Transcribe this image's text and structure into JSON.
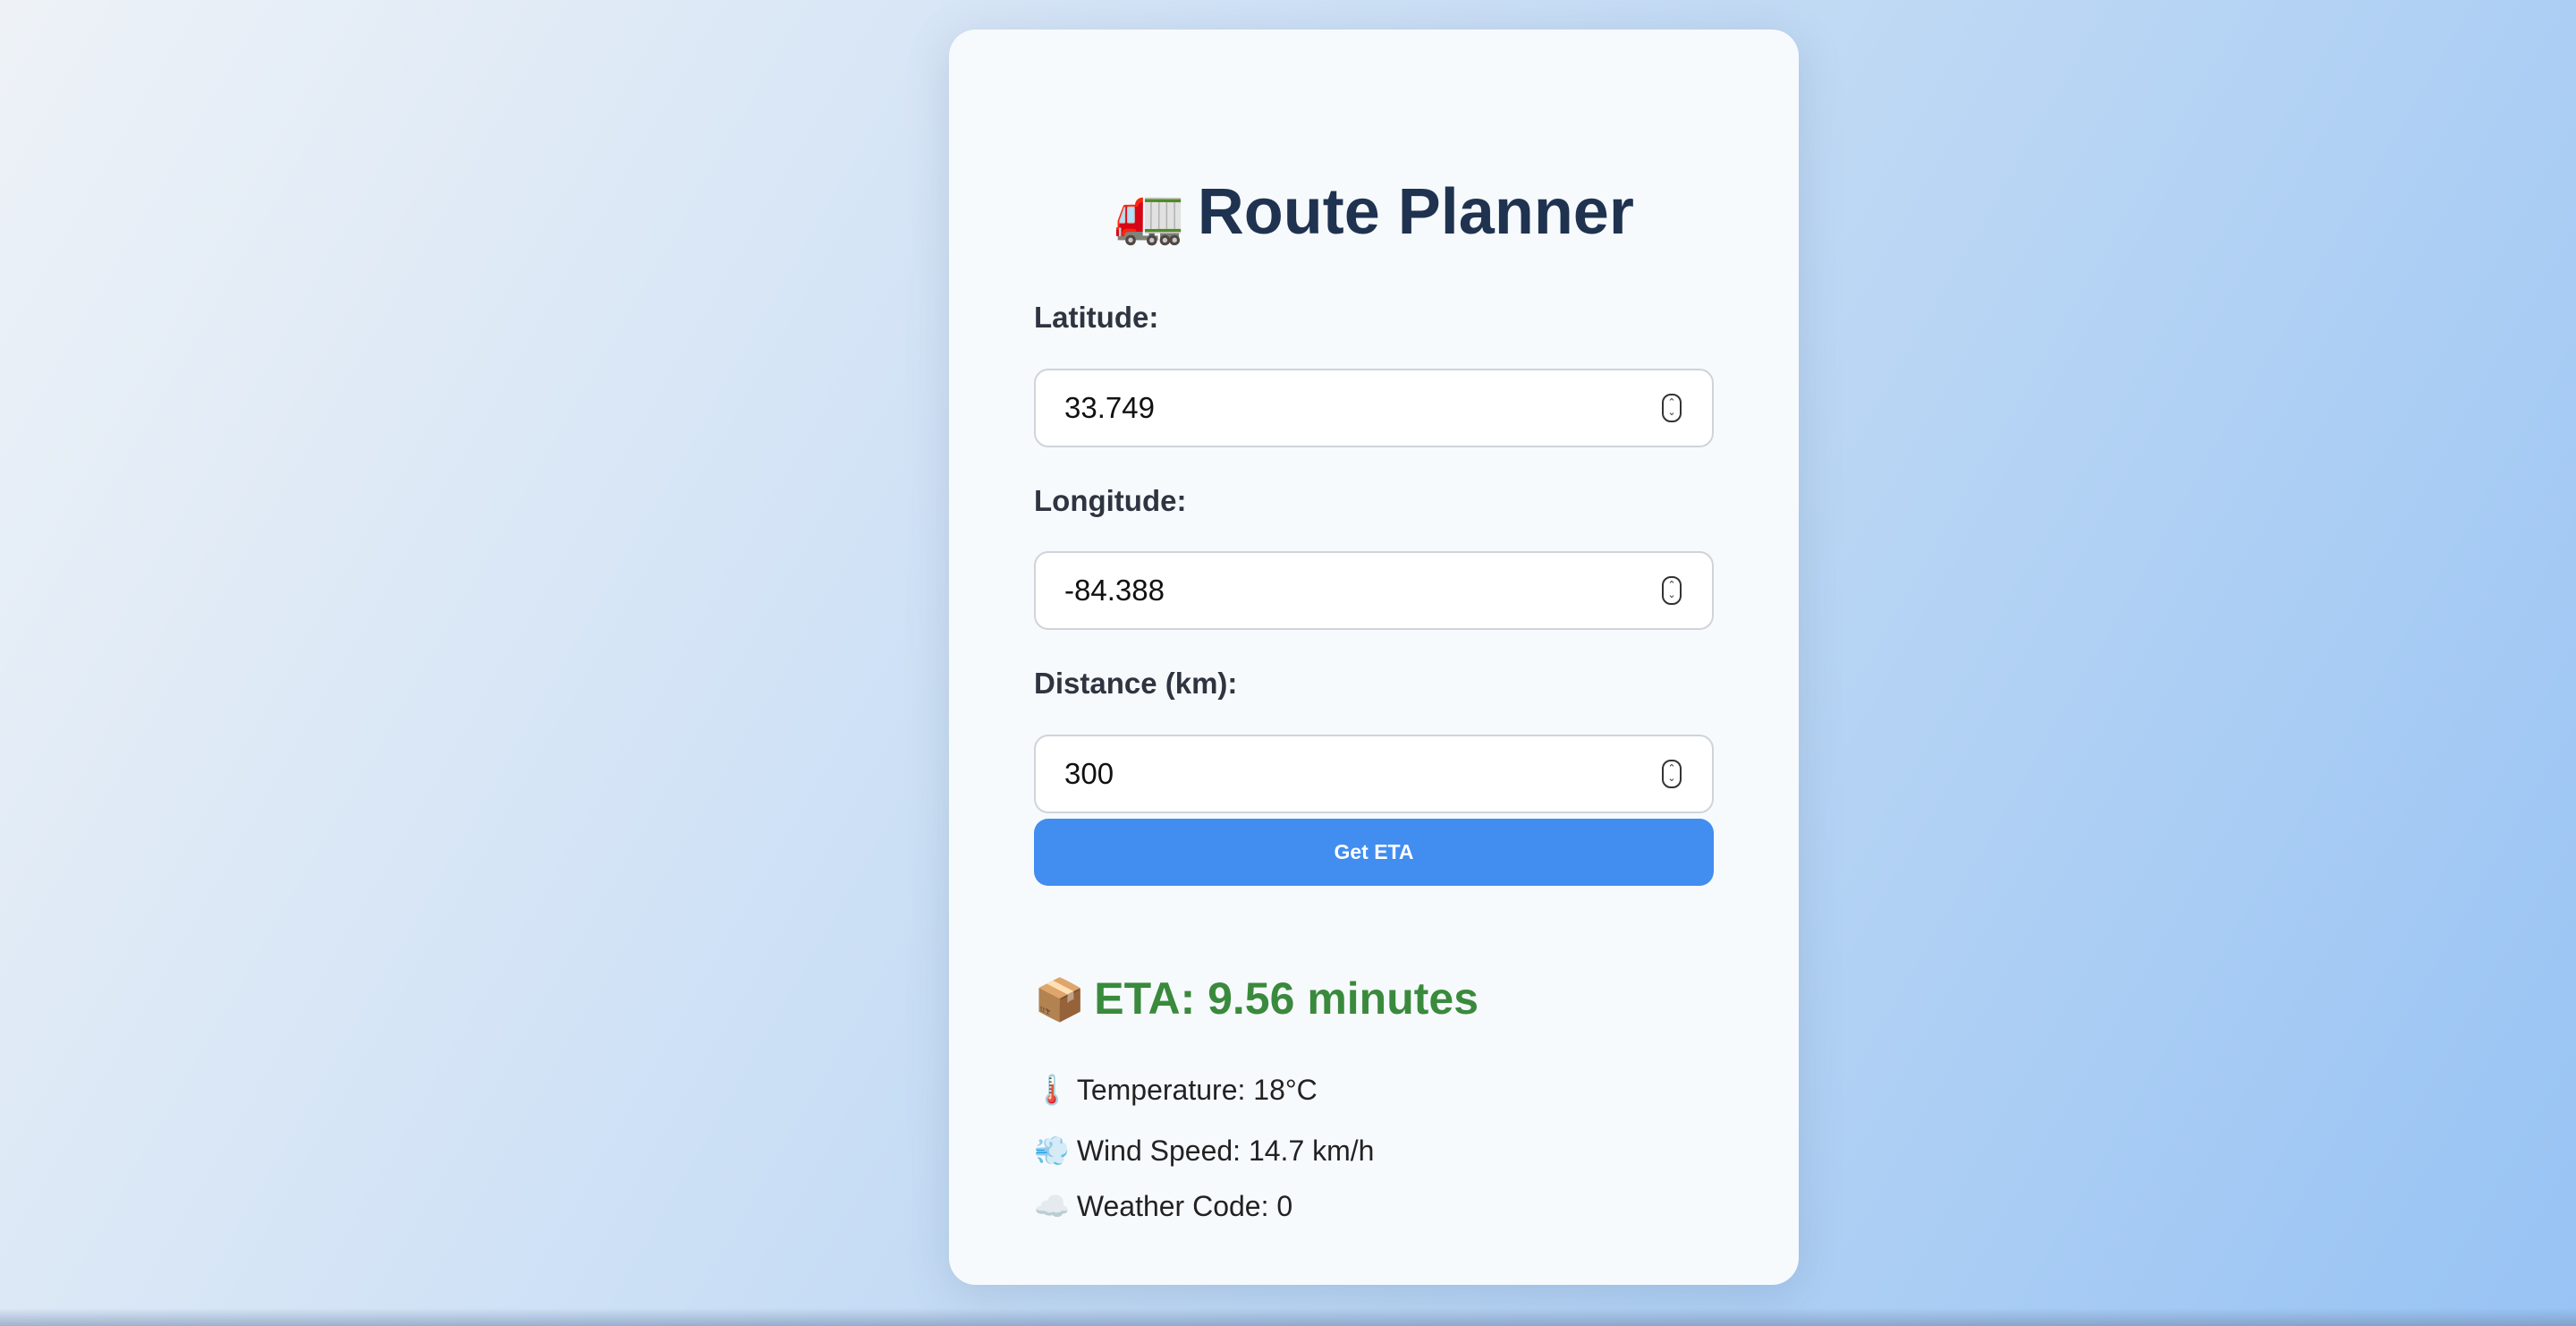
{
  "header": {
    "title_icon": "🚛",
    "title": "Route Planner"
  },
  "form": {
    "latitude": {
      "label": "Latitude:",
      "value": "33.749"
    },
    "longitude": {
      "label": "Longitude:",
      "value": "-84.388"
    },
    "distance": {
      "label": "Distance (km):",
      "value": "300"
    },
    "submit_label": "Get ETA"
  },
  "result": {
    "eta_icon": "📦",
    "eta_text": "ETA: 9.56 minutes",
    "temperature_icon": "🌡️",
    "temperature_text": "Temperature: 18°C",
    "wind_icon": "💨",
    "wind_text": "Wind Speed: 14.7 km/h",
    "weather_icon": "☁️",
    "weather_text": "Weather Code: 0"
  },
  "colors": {
    "accent": "#418df0",
    "title": "#1f3350",
    "eta": "#3a8a3d"
  }
}
